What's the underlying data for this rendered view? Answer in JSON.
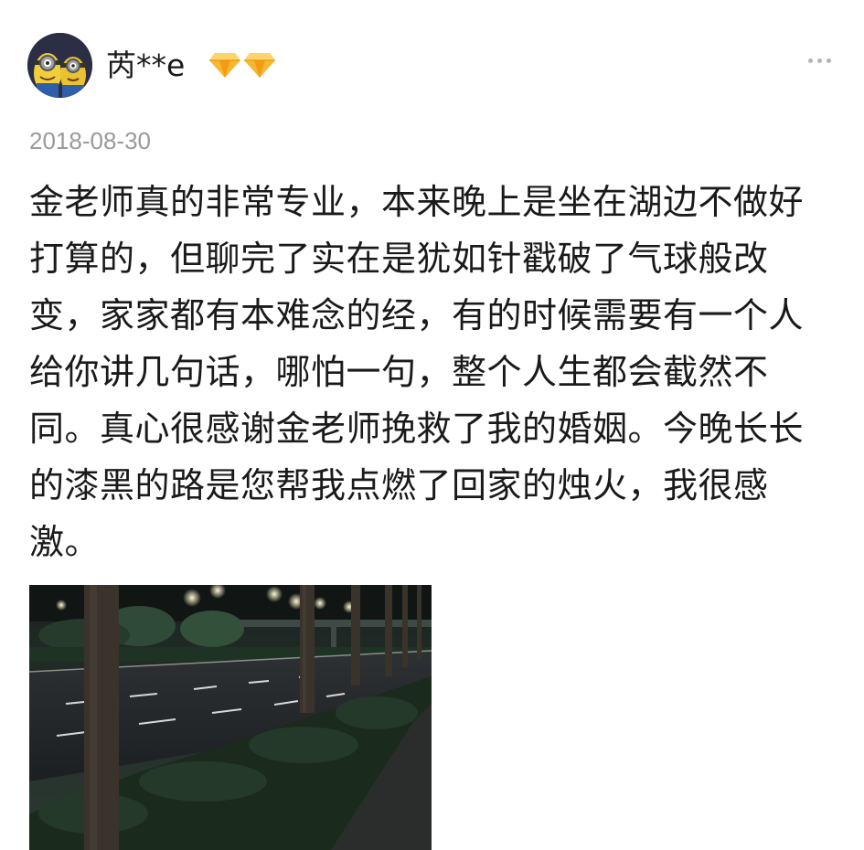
{
  "user": {
    "name": "芮**e",
    "avatar_icon": "minion-avatar-icon",
    "badge_icons": [
      "diamond-icon",
      "diamond-icon"
    ],
    "badge_color": "#f5a623"
  },
  "post": {
    "date": "2018-08-30",
    "text": "金老师真的非常专业，本来晚上是坐在湖边不做好打算的，但聊完了实在是犹如针戳破了气球般改变，家家都有本难念的经，有的时候需要有一个人给你讲几句话，哪怕一句，整个人生都会截然不同。真心很感谢金老师挽救了我的婚姻。今晚长长的漆黑的路是您帮我点燃了回家的烛火，我很感激。",
    "more_icon": "more-dots-icon",
    "photo_icon": "night-street-photo"
  }
}
